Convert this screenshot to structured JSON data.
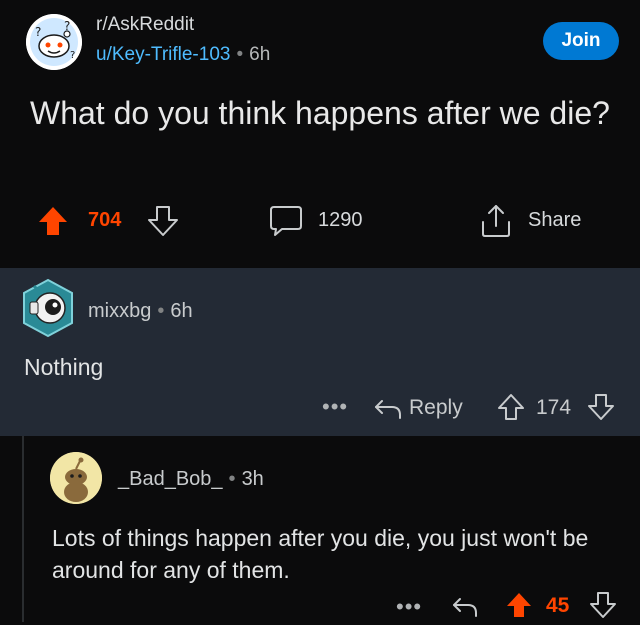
{
  "post": {
    "subreddit": "r/AskReddit",
    "author": "u/Key-Trifle-103",
    "separator": "•",
    "age": "6h",
    "join_label": "Join",
    "title": "What do you think happens after we die?",
    "score": "704",
    "comments": "1290",
    "share_label": "Share",
    "vote_state": "upvoted"
  },
  "comments": [
    {
      "username": "mixxbg",
      "separator": "•",
      "age": "6h",
      "body": "Nothing",
      "more": "•••",
      "reply_label": "Reply",
      "score": "174"
    },
    {
      "username": "_Bad_Bob_",
      "separator": "•",
      "age": "3h",
      "body": "Lots of things happen after you die, you just won't be around for any of them.",
      "more": "•••",
      "score": "45",
      "vote_state": "upvoted"
    }
  ],
  "colors": {
    "upvote": "#ff4500",
    "author_link": "#4fbcff",
    "join_button": "#0079d3",
    "highlighted_comment_bg": "#232a35"
  }
}
